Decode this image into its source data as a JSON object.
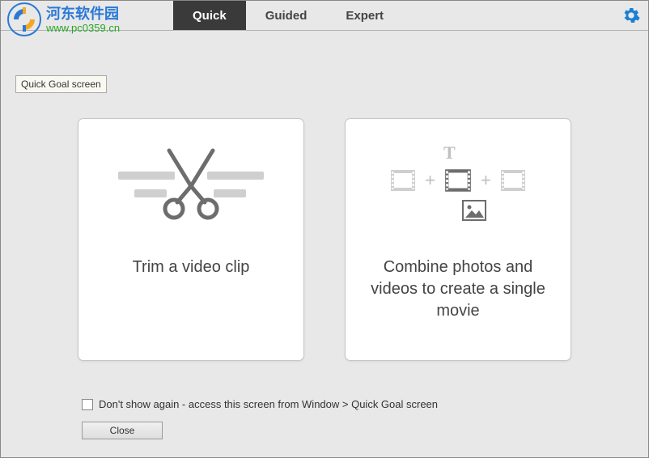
{
  "watermark": {
    "title": "河东软件园",
    "url": "www.pc0359.cn"
  },
  "tabs": {
    "quick": "Quick",
    "guided": "Guided",
    "expert": "Expert"
  },
  "tooltip": "Quick Goal screen",
  "cards": {
    "trim": "Trim a video clip",
    "combine": "Combine photos and videos to create a single movie"
  },
  "footer": {
    "dont_show": "Don't show again - access this screen from Window > Quick Goal screen",
    "close": "Close"
  },
  "colors": {
    "gear": "#1a7fd4",
    "icon_gray": "#bfbfbf",
    "icon_dark": "#6d6d6d"
  }
}
